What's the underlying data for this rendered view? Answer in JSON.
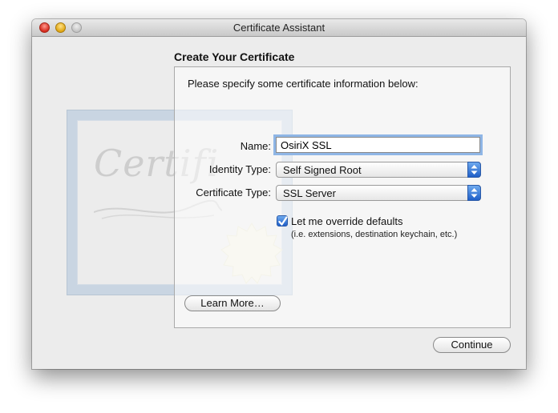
{
  "window": {
    "title": "Certificate Assistant"
  },
  "titlebar": {
    "buttons": [
      "close",
      "minimize",
      "zoom"
    ]
  },
  "watermark": {
    "text": "Certifi"
  },
  "heading": "Create Your Certificate",
  "panel": {
    "instruction": "Please specify some certificate information below:",
    "name_label": "Name:",
    "name_value": "OsiriX SSL",
    "identity_label": "Identity Type:",
    "identity_value": "Self Signed Root",
    "certtype_label": "Certificate Type:",
    "certtype_value": "SSL Server",
    "override_label": "Let me override defaults",
    "override_checked": true,
    "override_hint": "(i.e. extensions, destination keychain, etc.)",
    "learn_more": "Learn More…"
  },
  "footer": {
    "continue": "Continue"
  },
  "colors": {
    "focus_ring": "#8fb6e6",
    "accent_blue": "#2f6fd4",
    "window_bg": "#ececec"
  }
}
